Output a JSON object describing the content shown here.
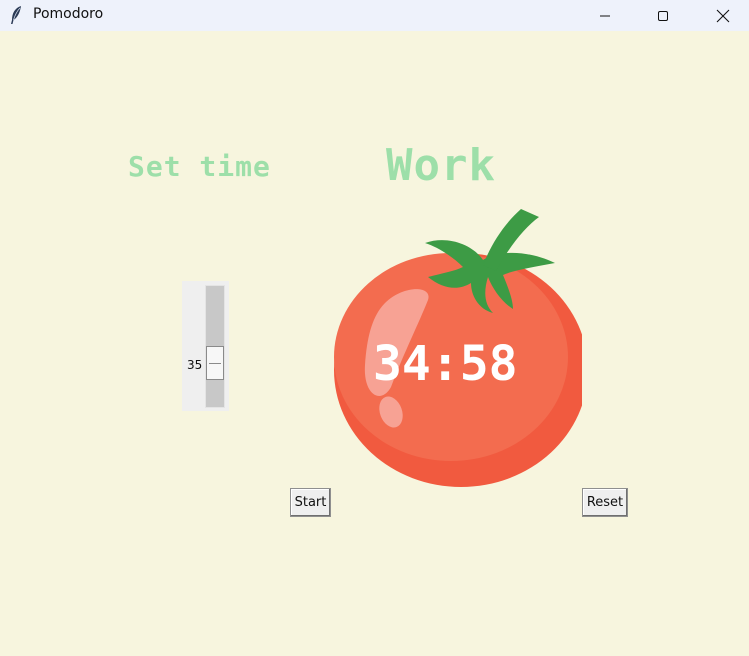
{
  "window": {
    "title": "Pomodoro",
    "controls": {
      "minimize_icon": "minimize-icon",
      "maximize_icon": "maximize-icon",
      "close_icon": "close-icon"
    }
  },
  "labels": {
    "set_time": "Set time",
    "mode": "Work"
  },
  "scale": {
    "value": "35"
  },
  "timer": {
    "display": "34:58"
  },
  "buttons": {
    "start": "Start",
    "reset": "Reset"
  },
  "colors": {
    "background": "#f7f5de",
    "label_green": "#9ddfa9",
    "tomato_red": "#f06a4c",
    "leaf_green": "#3d9b45"
  }
}
